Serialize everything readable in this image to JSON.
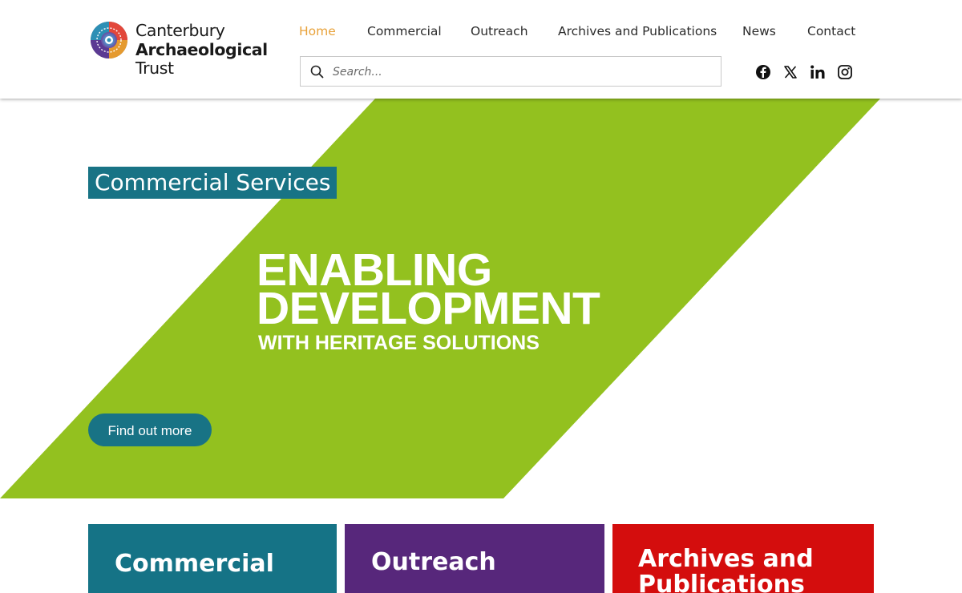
{
  "brand": {
    "line1": "Canterbury",
    "line2": "Archaeological",
    "line3": "Trust"
  },
  "nav": {
    "items": [
      {
        "label": "Home",
        "active": true
      },
      {
        "label": "Commercial",
        "active": false
      },
      {
        "label": "Outreach",
        "active": false
      },
      {
        "label": "Archives and Publications",
        "active": false
      },
      {
        "label": "News",
        "active": false
      },
      {
        "label": "Contact",
        "active": false
      }
    ],
    "active_color": "#e8a23a"
  },
  "search": {
    "placeholder": "Search...",
    "icon": "search-icon"
  },
  "social": [
    "facebook-icon",
    "x-icon",
    "linkedin-icon",
    "instagram-icon"
  ],
  "hero": {
    "tag": "Commercial Services",
    "headline_1": "ENABLING",
    "headline_2": "DEVELOPMENT",
    "headline_3": "WITH HERITAGE SOLUTIONS",
    "cta_label": "Find out more",
    "band_color": "#93c11f",
    "accent_color": "#187385"
  },
  "cards": [
    {
      "title": "Commercial",
      "color": "#157386"
    },
    {
      "title": "Outreach",
      "color": "#57277b"
    },
    {
      "title": "Archives and Publications",
      "color": "#d40d0d"
    }
  ]
}
